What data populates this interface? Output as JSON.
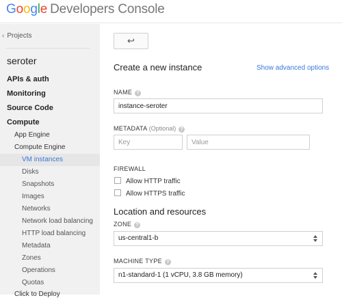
{
  "header": {
    "logo_google": [
      "G",
      "o",
      "o",
      "g",
      "l",
      "e"
    ],
    "logo_rest": "Developers Console",
    "logo_colors": [
      "#4285f4",
      "#ea4335",
      "#fbbc05",
      "#4285f4",
      "#34a853",
      "#ea4335"
    ]
  },
  "sidebar": {
    "projects_link": "Projects",
    "project_name": "seroter",
    "sections": {
      "apis": "APIs & auth",
      "monitoring": "Monitoring",
      "source_code": "Source Code",
      "compute": "Compute"
    },
    "compute_sub": {
      "app_engine": "App Engine",
      "compute_engine": "Compute Engine"
    },
    "compute_engine_items": [
      "VM instances",
      "Disks",
      "Snapshots",
      "Images",
      "Networks",
      "Network load balancing",
      "HTTP load balancing",
      "Metadata",
      "Zones",
      "Operations",
      "Quotas"
    ],
    "active_item": "VM instances",
    "partial_item": "Click to Deploy",
    "active_color": "#3a77d8"
  },
  "main": {
    "back_icon": "arrow-left-icon",
    "title": "Create a new instance",
    "advanced_link": "Show advanced options",
    "name": {
      "label": "NAME",
      "value": "instance-seroter"
    },
    "metadata": {
      "label": "METADATA",
      "optional": "(Optional)",
      "key_placeholder": "Key",
      "value_placeholder": "Value"
    },
    "firewall": {
      "label": "FIREWALL",
      "http": "Allow HTTP traffic",
      "https": "Allow HTTPS traffic"
    },
    "location_heading": "Location and resources",
    "zone": {
      "label": "ZONE",
      "value": "us-central1-b"
    },
    "machine_type": {
      "label": "MACHINE TYPE",
      "value": "n1-standard-1 (1 vCPU, 3.8 GB memory)"
    }
  }
}
